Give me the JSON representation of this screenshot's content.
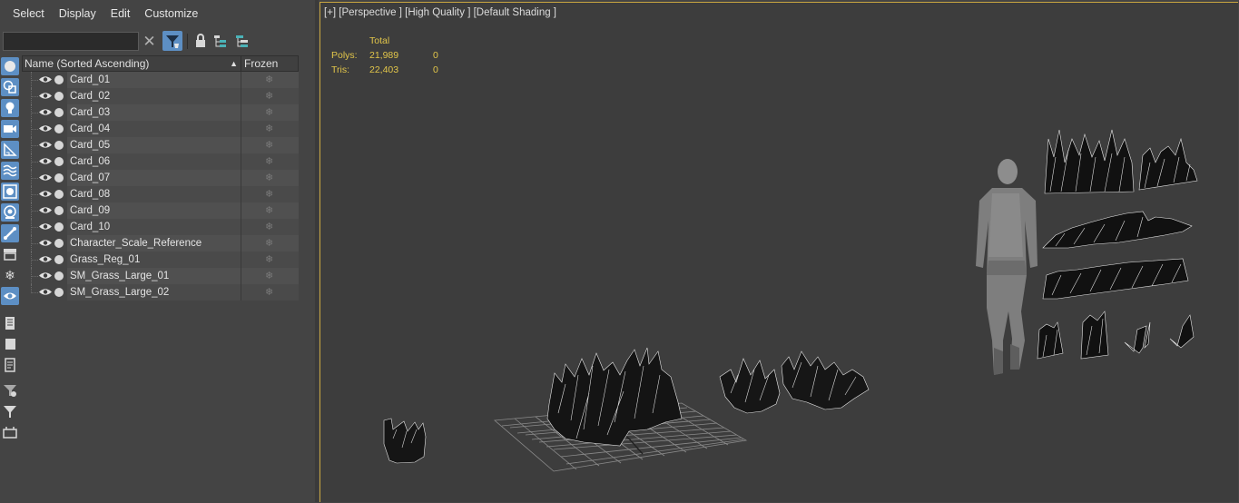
{
  "menubar": {
    "items": [
      "Select",
      "Display",
      "Edit",
      "Customize"
    ]
  },
  "toolbar": {
    "search_value": "",
    "icons": [
      "clear-icon",
      "filter-icon",
      "lock-icon",
      "hierarchy-icon",
      "hierarchy-alt-icon"
    ]
  },
  "side_strip": {
    "icons": [
      "geometry-icon",
      "shapes-icon",
      "lights-icon",
      "cameras-icon",
      "helpers-icon",
      "spacewarps-icon",
      "groups-icon",
      "xrefs-icon",
      "bones-icon",
      "containers-icon",
      "frozen-icon",
      "hidden-icon",
      "layer-icon",
      "select-all-icon",
      "properties-icon",
      "filter-options-icon",
      "filter-icon",
      "expand-icon"
    ]
  },
  "tree": {
    "col_name": "Name (Sorted Ascending)",
    "col_frozen": "Frozen",
    "sort_indicator": "▲",
    "frozen_glyph": "❄",
    "rows": [
      "Card_01",
      "Card_02",
      "Card_03",
      "Card_04",
      "Card_05",
      "Card_06",
      "Card_07",
      "Card_08",
      "Card_09",
      "Card_10",
      "Character_Scale_Reference",
      "Grass_Reg_01",
      "SM_Grass_Large_01",
      "SM_Grass_Large_02"
    ]
  },
  "viewport": {
    "label": "[+] [Perspective ] [High Quality ] [Default Shading ]",
    "stats": {
      "header": "Total",
      "polys_label": "Polys:",
      "polys_total": "21,989",
      "polys_selected": "0",
      "tris_label": "Tris:",
      "tris_total": "22,403",
      "tris_selected": "0"
    }
  },
  "colors": {
    "accent_blue": "#5d8fc4",
    "viewport_border": "#c8a640",
    "stats_text": "#e2c64a",
    "panel_bg": "#444444",
    "viewport_bg": "#3d3d3d"
  }
}
